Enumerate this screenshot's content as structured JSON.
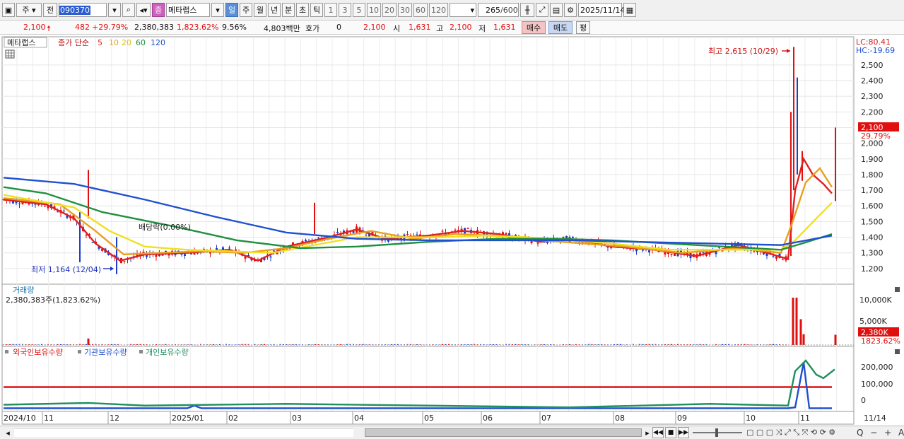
{
  "toolbar": {
    "type_label": "주",
    "prev_label": "전",
    "code": "090370",
    "kind_badge": "증",
    "stock_name": "메타랩스",
    "periods": [
      "일",
      "주",
      "월",
      "년",
      "분",
      "초",
      "틱"
    ],
    "active_period": "일",
    "intervals": [
      "1",
      "3",
      "5",
      "10",
      "20",
      "30",
      "60",
      "120"
    ],
    "count": "265",
    "count_max": "/600",
    "date": "2025/11/14"
  },
  "quote": {
    "price": "2,100",
    "change": "482",
    "change_pct": "+29.79%",
    "volume": "2,380,383",
    "volume_pct": "1,823.62%",
    "turnover_pct": "9.56%",
    "amount": "4,803백만",
    "hoga_label": "호가",
    "hoga_value": "0",
    "hoga_price": "2,100",
    "open_label": "시",
    "open": "1,631",
    "high_label": "고",
    "high": "2,100",
    "low_label": "저",
    "low": "1,631",
    "buy_label": "매수",
    "sell_label": "매도",
    "avg_label": "평"
  },
  "main_panel": {
    "name_tag": "메타랩스",
    "ma_title": "종가 단순",
    "ma_periods": [
      {
        "label": "5",
        "color": "#e02020"
      },
      {
        "label": "10",
        "color": "#e8a020"
      },
      {
        "label": "20",
        "color": "#e8d020"
      },
      {
        "label": "60",
        "color": "#209040"
      },
      {
        "label": "120",
        "color": "#2050d0"
      }
    ],
    "lc_label": "LC:80.41",
    "hc_label": "HC:-19.69",
    "high_annotation": "최고 2,615 (10/29)",
    "low_annotation": "최저 1,164 (12/04)",
    "dividend_annotation": "배당락(0.00%)",
    "current_price_tag": "2,100",
    "current_pct_tag": "29.79%",
    "y_ticks": [
      "2,500",
      "2,400",
      "2,300",
      "2,200",
      "2,100",
      "2,000",
      "1,900",
      "1,800",
      "1,700",
      "1,600",
      "1,500",
      "1,400",
      "1,300",
      "1,200"
    ]
  },
  "volume_panel": {
    "title": "거래량",
    "value_text": "2,380,383주(1,823.62%)",
    "y_ticks": [
      "10,000K",
      "5,000K"
    ],
    "current_tag": "2,380K",
    "current_pct": "1823.62%"
  },
  "holding_panel": {
    "legends": [
      {
        "label": "외국인보유수량",
        "color": "#e01010"
      },
      {
        "label": "기관보유수량",
        "color": "#2050d0"
      },
      {
        "label": "개인보유수량",
        "color": "#209060"
      }
    ],
    "y_ticks": [
      "200,000",
      "100,000",
      "0"
    ]
  },
  "x_axis": [
    "2024/10",
    "11",
    "12",
    "2025/01",
    "02",
    "03",
    "04",
    "05",
    "06",
    "07",
    "08",
    "09",
    "10",
    "11",
    "11/14"
  ],
  "colors": {
    "up": "#e01010",
    "down": "#1a3fd0",
    "accent": "#5a8fd8"
  },
  "chart_data": {
    "type": "candlestick",
    "title": "메타랩스",
    "y_range": [
      1100,
      2680
    ],
    "high_point": {
      "value": 2615,
      "date": "10/29"
    },
    "low_point": {
      "value": 1164,
      "date": "12/04"
    },
    "last_close": 2100,
    "moving_averages": {
      "ma5": [
        [
          0,
          1640
        ],
        [
          60,
          1610
        ],
        [
          100,
          1520
        ],
        [
          130,
          1360
        ],
        [
          165,
          1250
        ],
        [
          200,
          1290
        ],
        [
          260,
          1300
        ],
        [
          320,
          1320
        ],
        [
          360,
          1250
        ],
        [
          400,
          1340
        ],
        [
          460,
          1400
        ],
        [
          500,
          1450
        ],
        [
          540,
          1390
        ],
        [
          600,
          1410
        ],
        [
          650,
          1440
        ],
        [
          700,
          1420
        ],
        [
          760,
          1370
        ],
        [
          800,
          1390
        ],
        [
          860,
          1340
        ],
        [
          920,
          1320
        ],
        [
          980,
          1280
        ],
        [
          1040,
          1350
        ],
        [
          1080,
          1300
        ],
        [
          1110,
          1260
        ],
        [
          1120,
          1700
        ],
        [
          1132,
          1900
        ],
        [
          1145,
          1800
        ],
        [
          1160,
          1740
        ],
        [
          1172,
          1680
        ]
      ],
      "ma10": [
        [
          0,
          1650
        ],
        [
          80,
          1610
        ],
        [
          130,
          1440
        ],
        [
          170,
          1290
        ],
        [
          220,
          1300
        ],
        [
          280,
          1310
        ],
        [
          340,
          1300
        ],
        [
          400,
          1330
        ],
        [
          460,
          1390
        ],
        [
          520,
          1440
        ],
        [
          580,
          1390
        ],
        [
          640,
          1420
        ],
        [
          700,
          1410
        ],
        [
          760,
          1380
        ],
        [
          820,
          1360
        ],
        [
          880,
          1340
        ],
        [
          960,
          1300
        ],
        [
          1040,
          1330
        ],
        [
          1100,
          1300
        ],
        [
          1115,
          1480
        ],
        [
          1135,
          1750
        ],
        [
          1155,
          1840
        ],
        [
          1172,
          1720
        ]
      ],
      "ma20": [
        [
          0,
          1670
        ],
        [
          100,
          1590
        ],
        [
          150,
          1440
        ],
        [
          200,
          1340
        ],
        [
          260,
          1320
        ],
        [
          320,
          1310
        ],
        [
          380,
          1300
        ],
        [
          440,
          1350
        ],
        [
          500,
          1400
        ],
        [
          560,
          1400
        ],
        [
          620,
          1400
        ],
        [
          680,
          1410
        ],
        [
          740,
          1400
        ],
        [
          800,
          1380
        ],
        [
          860,
          1360
        ],
        [
          940,
          1320
        ],
        [
          1020,
          1320
        ],
        [
          1100,
          1320
        ],
        [
          1120,
          1380
        ],
        [
          1150,
          1520
        ],
        [
          1172,
          1620
        ]
      ],
      "ma60": [
        [
          0,
          1720
        ],
        [
          60,
          1680
        ],
        [
          140,
          1560
        ],
        [
          240,
          1470
        ],
        [
          330,
          1380
        ],
        [
          420,
          1330
        ],
        [
          500,
          1340
        ],
        [
          600,
          1370
        ],
        [
          700,
          1390
        ],
        [
          780,
          1390
        ],
        [
          860,
          1380
        ],
        [
          940,
          1360
        ],
        [
          1020,
          1340
        ],
        [
          1100,
          1320
        ],
        [
          1130,
          1360
        ],
        [
          1172,
          1420
        ]
      ],
      "ma120": [
        [
          0,
          1780
        ],
        [
          100,
          1740
        ],
        [
          200,
          1640
        ],
        [
          300,
          1530
        ],
        [
          400,
          1430
        ],
        [
          500,
          1390
        ],
        [
          600,
          1380
        ],
        [
          700,
          1380
        ],
        [
          800,
          1380
        ],
        [
          900,
          1370
        ],
        [
          1000,
          1360
        ],
        [
          1100,
          1350
        ],
        [
          1172,
          1410
        ]
      ]
    },
    "volume_spikes": [
      {
        "x": 120,
        "value": 1500
      },
      {
        "x": 1117,
        "value": 11000
      },
      {
        "x": 1122,
        "value": 11000
      },
      {
        "x": 1128,
        "value": 6000
      },
      {
        "x": 1132,
        "value": 2500
      },
      {
        "x": 1177,
        "value": 2380
      }
    ],
    "holdings": {
      "foreign": [
        [
          0,
          110000
        ],
        [
          1172,
          110000
        ]
      ],
      "institution": [
        [
          0,
          -10000
        ],
        [
          260,
          -10000
        ],
        [
          270,
          5000
        ],
        [
          280,
          -10000
        ],
        [
          1110,
          -10000
        ],
        [
          1120,
          -5000
        ],
        [
          1132,
          250000
        ],
        [
          1140,
          -10000
        ],
        [
          1172,
          -10000
        ]
      ],
      "individual": [
        [
          0,
          10000
        ],
        [
          120,
          20000
        ],
        [
          200,
          5000
        ],
        [
          400,
          15000
        ],
        [
          600,
          5000
        ],
        [
          800,
          -5000
        ],
        [
          1000,
          15000
        ],
        [
          1110,
          5000
        ],
        [
          1120,
          200000
        ],
        [
          1135,
          260000
        ],
        [
          1150,
          180000
        ],
        [
          1160,
          160000
        ],
        [
          1176,
          210000
        ]
      ]
    }
  },
  "bottom_bar": {
    "zoom_label": "Q − + A"
  }
}
